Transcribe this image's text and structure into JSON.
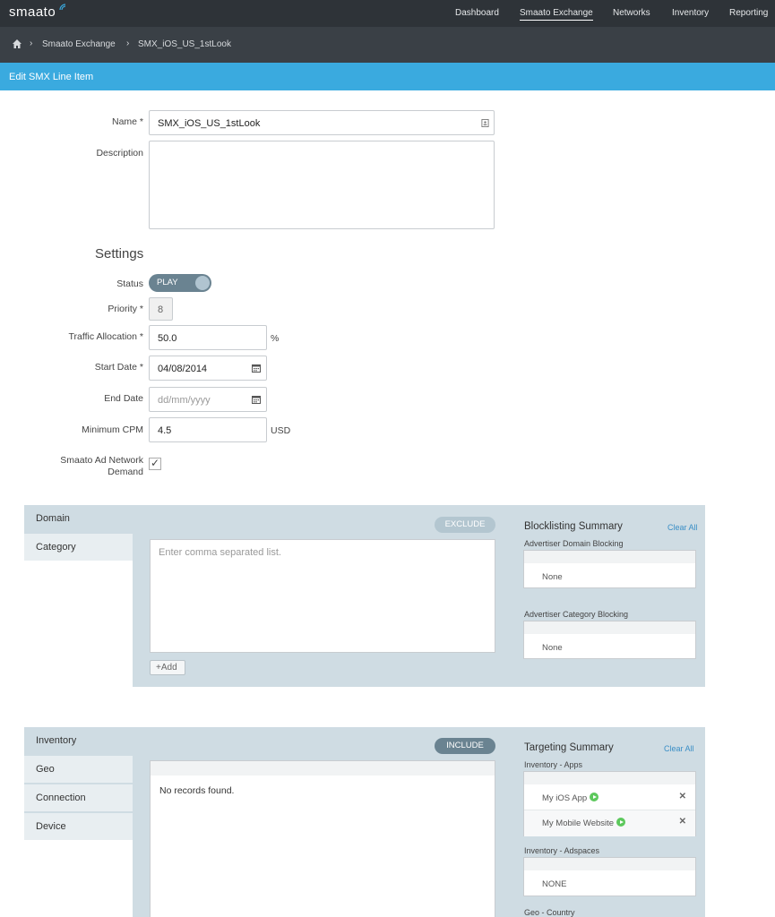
{
  "nav": {
    "brand": "smaato",
    "items": [
      "Dashboard",
      "Smaato Exchange",
      "Networks",
      "Inventory",
      "Reporting"
    ]
  },
  "breadcrumb": {
    "items": [
      "Smaato Exchange",
      "SMX_iOS_US_1stLook"
    ]
  },
  "page": {
    "title": "Edit SMX Line Item"
  },
  "form": {
    "name_label": "Name *",
    "name_value": "SMX_iOS_US_1stLook",
    "description_label": "Description",
    "settings_heading": "Settings",
    "status_label": "Status",
    "status_value": "PLAY",
    "priority_label": "Priority *",
    "priority_value": "8",
    "traffic_label": "Traffic Allocation *",
    "traffic_value": "50.0",
    "traffic_unit": "%",
    "start_label": "Start Date *",
    "start_value": "04/08/2014",
    "end_label": "End Date",
    "end_placeholder": "dd/mm/yyyy",
    "cpm_label": "Minimum CPM",
    "cpm_value": "4.5",
    "cpm_unit": "USD",
    "smaato_label_1": "Smaato Ad Network",
    "smaato_label_2": "Demand",
    "smaato_checked": true
  },
  "blocklist": {
    "tabs": [
      "Domain",
      "Category"
    ],
    "pill": "EXCLUDE",
    "placeholder": "Enter comma separated list.",
    "add_label": "+Add",
    "summary_title": "Blocklisting Summary",
    "clear_all": "Clear All",
    "domain_title": "Advertiser Domain Blocking",
    "domain_value": "None",
    "category_title": "Advertiser Category Blocking",
    "category_value": "None"
  },
  "targeting": {
    "tabs": [
      "Inventory",
      "Geo",
      "Connection",
      "Device"
    ],
    "pill": "INCLUDE",
    "no_records": "No records found.",
    "summary_title": "Targeting Summary",
    "clear_all": "Clear All",
    "apps_title": "Inventory - Apps",
    "apps": [
      "My iOS App",
      "My Mobile Website"
    ],
    "adspaces_title": "Inventory - Adspaces",
    "adspaces_value": "NONE",
    "geo_title": "Geo - Country"
  },
  "colors": {
    "nav_bg": "#2e3338",
    "breadcrumb_bg": "#3a4046",
    "title_bar": "#3aaadf",
    "panel_bg": "#cfdce3",
    "toggle": "#6a8391",
    "exclude_pill": "#b3c6d0",
    "include_pill": "#6a8391",
    "link": "#3a8ec6"
  }
}
